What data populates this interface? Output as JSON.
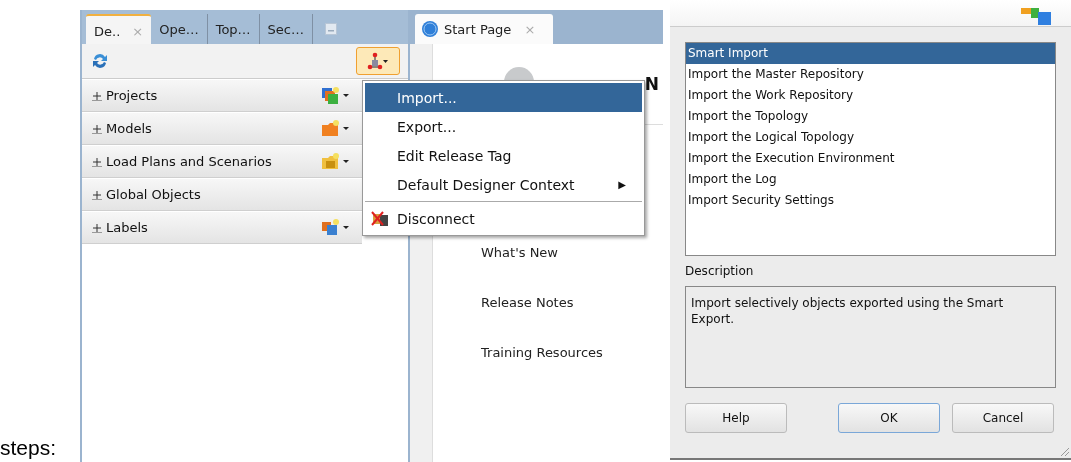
{
  "caption": "steps:",
  "designer": {
    "tabs": [
      {
        "label": "De..",
        "selected": true,
        "close": "×"
      },
      {
        "label": "Ope…",
        "selected": false
      },
      {
        "label": "Top…",
        "selected": false
      },
      {
        "label": "Sec…",
        "selected": false
      }
    ],
    "accordion": [
      {
        "label": "Projects",
        "expanded": false,
        "kind": "projects"
      },
      {
        "label": "Models",
        "expanded": false,
        "kind": "models"
      },
      {
        "label": "Load Plans and Scenarios",
        "expanded": false,
        "kind": "scenarios"
      },
      {
        "label": "Global Objects",
        "expanded": false,
        "kind": "none"
      },
      {
        "label": "Labels",
        "expanded": false,
        "kind": "labels"
      }
    ]
  },
  "menu": [
    {
      "kind": "item",
      "label": "Import...",
      "selected": true
    },
    {
      "kind": "item",
      "label": "Export...",
      "selected": false
    },
    {
      "kind": "item",
      "label": "Edit Release Tag",
      "selected": false
    },
    {
      "kind": "submenu",
      "label": "Default Designer Context",
      "arrow": "▶",
      "selected": false
    },
    {
      "kind": "separator"
    },
    {
      "kind": "icon",
      "label": "Disconnect",
      "selected": false
    }
  ],
  "start_page": {
    "tab": {
      "label": "Start Page",
      "close": "×",
      "selected": true
    },
    "heading": "N",
    "links": [
      "What's New",
      "Release Notes",
      "Training Resources"
    ]
  },
  "import_dialog": {
    "options": [
      {
        "label": "Smart Import",
        "selected": true
      },
      {
        "label": "Import the Master Repository",
        "selected": false
      },
      {
        "label": "Import the Work Repository",
        "selected": false
      },
      {
        "label": "Import the Topology",
        "selected": false
      },
      {
        "label": "Import the Logical Topology",
        "selected": false
      },
      {
        "label": "Import the Execution Environment",
        "selected": false
      },
      {
        "label": "Import the Log",
        "selected": false
      },
      {
        "label": "Import Security Settings",
        "selected": false
      }
    ],
    "description_label": "Description",
    "description": "Import selectively objects exported using the Smart Export.",
    "buttons": [
      {
        "label": "Help",
        "default": false
      },
      {
        "label": "OK",
        "default": true
      },
      {
        "label": "Cancel",
        "default": false
      }
    ]
  }
}
